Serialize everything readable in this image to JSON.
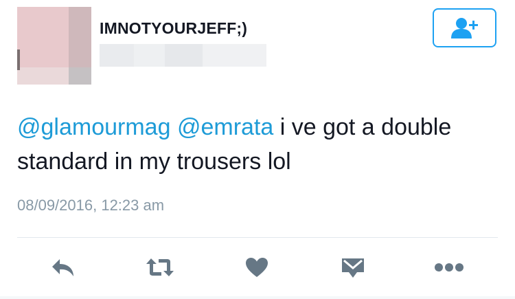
{
  "tweet": {
    "display_name": "IMNOTYOURJEFF;)",
    "text_parts": {
      "mention_1": "@glamourmag",
      "mention_2": "@emrata",
      "body": " i ve got a double standard in my trousers lol"
    },
    "timestamp": "08/09/2016, 12:23 am"
  },
  "icons": {
    "follow": "add-user-icon",
    "reply": "reply-icon",
    "retweet": "retweet-icon",
    "like": "heart-icon",
    "message": "envelope-icon",
    "more": "more-dots-icon"
  },
  "colors": {
    "accent": "#1da1f2",
    "mention": "#1d9bd7",
    "icon": "#667785",
    "meta": "#8899a6",
    "text": "#141823"
  }
}
